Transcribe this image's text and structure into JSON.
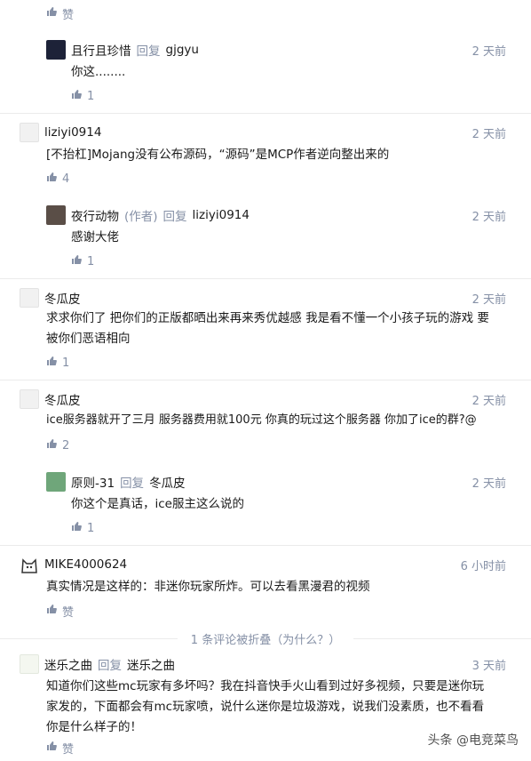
{
  "like_label": "赞",
  "comments": [
    {
      "name": "且行且珍惜",
      "reply_word": "回复",
      "target": "gjgyu",
      "time": "2 天前",
      "text": "你这........",
      "likes": "1"
    },
    {
      "name": "liziyi0914",
      "time": "2 天前",
      "text": "[不抬杠]Mojang没有公布源码，“源码”是MCP作者逆向整出来的",
      "likes": "4"
    },
    {
      "name": "夜行动物",
      "tag": "(作者)",
      "reply_word": "回复",
      "target": "liziyi0914",
      "time": "2 天前",
      "text": "感谢大佬",
      "likes": "1"
    },
    {
      "name": "冬瓜皮",
      "time": "2 天前",
      "text_line1": "求求你们了 把你们的正版都晒出来再来秀优越感 我是看不懂一个小孩子玩的游戏 要",
      "text_line2": "被你们恶语相向",
      "likes": "1"
    },
    {
      "name": "冬瓜皮",
      "time": "2 天前",
      "text": "ice服务器就开了三月 服务器费用就100元 你真的玩过这个服务器 你加了ice的群?@",
      "likes": "2"
    },
    {
      "name": "原则-31",
      "reply_word": "回复",
      "target": "冬瓜皮",
      "time": "2 天前",
      "text": "你这个是真话，ice服主这么说的",
      "likes": "1"
    },
    {
      "name": "MIKE4000624",
      "time": "6 小时前",
      "text": "真实情况是这样的：非迷你玩家所炸。可以去看黑漫君的视频"
    },
    {
      "name": "迷乐之曲",
      "reply_word": "回复",
      "target": "迷乐之曲",
      "time": "3 天前",
      "text_line1": "知道你们这些mc玩家有多坏吗？我在抖音快手火山看到过好多视频，只要是迷你玩",
      "text_line2": "家发的，下面都会有mc玩家喷，说什么迷你是垃圾游戏，说我们没素质，也不看看",
      "text_line3": "你是什么样子的！"
    }
  ],
  "collapsed_notice": "1 条评论被折叠（为什么？）",
  "watermark": "头条 @电竞菜鸟"
}
